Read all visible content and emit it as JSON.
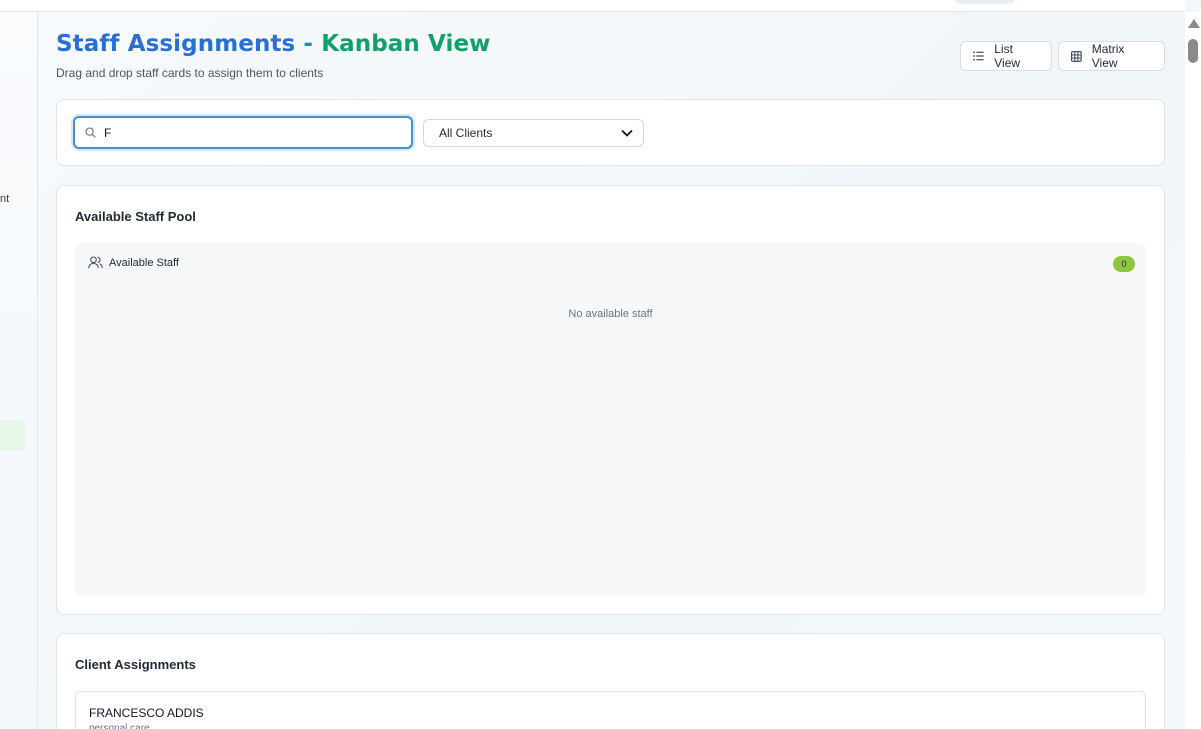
{
  "header": {
    "title_part1": "Staff Assignments",
    "title_separator": " - ",
    "title_part2": "Kanban View",
    "subtitle": "Drag and drop staff cards to assign them to clients"
  },
  "view_switcher": {
    "list_label": "List View",
    "list_icon": "list-icon",
    "matrix_label": "Matrix View",
    "matrix_icon": "grid-icon"
  },
  "sidebar": {
    "partial_label": "nt"
  },
  "filters": {
    "search_value": "F",
    "search_icon": "search-icon",
    "client_select_value": "All Clients"
  },
  "staff_pool": {
    "heading": "Available Staff Pool",
    "column_title": "Available Staff",
    "column_icon": "users-icon",
    "count": "0",
    "empty_message": "No available staff"
  },
  "client_assignments": {
    "heading": "Client Assignments",
    "clients": [
      {
        "name": "FRANCESCO ADDIS",
        "type": "personal care"
      }
    ]
  },
  "colors": {
    "title_blue": "#2a6fd6",
    "title_green": "#12a06a",
    "badge_green": "#8cc63f",
    "focus_blue": "#4a90c8"
  }
}
